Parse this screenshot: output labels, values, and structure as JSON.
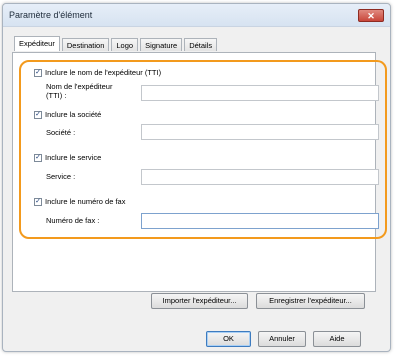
{
  "window": {
    "title": "Paramètre d'élément",
    "close_glyph": "✕"
  },
  "tabs": [
    {
      "label": "Expéditeur",
      "active": true
    },
    {
      "label": "Destination",
      "active": false
    },
    {
      "label": "Logo",
      "active": false
    },
    {
      "label": "Signature",
      "active": false
    },
    {
      "label": "Détails",
      "active": false
    }
  ],
  "sender": {
    "include_name": {
      "label": "Inclure le nom de l'expéditeur (TTI)",
      "checked": true
    },
    "name_field": {
      "label": "Nom de l'expéditeur (TTI) :",
      "value": ""
    },
    "include_company": {
      "label": "Inclure la société",
      "checked": true
    },
    "company_field": {
      "label": "Société :",
      "value": ""
    },
    "include_department": {
      "label": "Inclure le service",
      "checked": true
    },
    "department_field": {
      "label": "Service :",
      "value": ""
    },
    "include_fax": {
      "label": "Inclure le numéro de fax",
      "checked": true
    },
    "fax_field": {
      "label": "Numéro de fax :",
      "value": ""
    }
  },
  "buttons": {
    "import_sender": "Importer l'expéditeur...",
    "save_sender": "Enregistrer l'expéditeur...",
    "ok": "OK",
    "cancel": "Annuler",
    "help": "Aide"
  },
  "check_glyph": "✓",
  "colors": {
    "highlight": "#f39a1d",
    "close_button": "#c9463a"
  }
}
